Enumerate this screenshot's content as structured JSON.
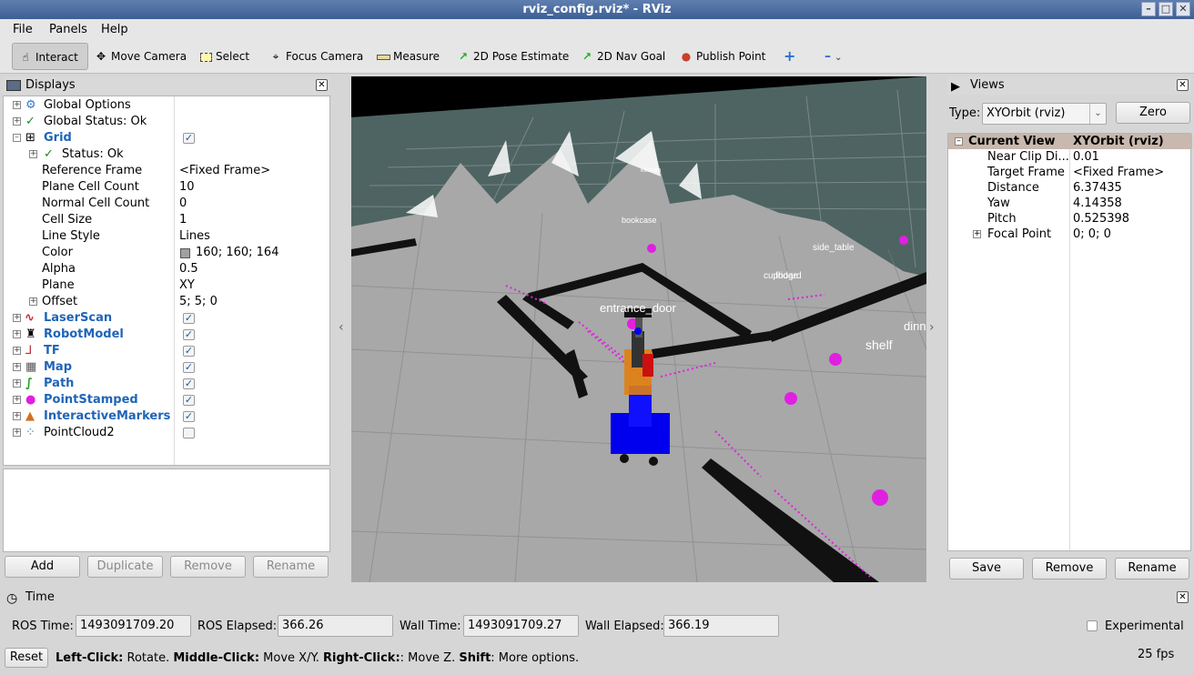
{
  "window": {
    "title": "rviz_config.rviz* - RViz"
  },
  "menu": [
    "File",
    "Panels",
    "Help"
  ],
  "toolbar": {
    "interact": "Interact",
    "move_camera": "Move Camera",
    "select": "Select",
    "focus_camera": "Focus Camera",
    "measure": "Measure",
    "pose_estimate": "2D Pose Estimate",
    "nav_goal": "2D Nav Goal",
    "publish_point": "Publish Point"
  },
  "displays": {
    "title": "Displays",
    "rows": [
      {
        "label": "Global Options"
      },
      {
        "label": "Global Status: Ok"
      },
      {
        "label": "Grid"
      },
      {
        "label": "Status: Ok"
      },
      {
        "label": "Reference Frame",
        "value": "<Fixed Frame>"
      },
      {
        "label": "Plane Cell Count",
        "value": "10"
      },
      {
        "label": "Normal Cell Count",
        "value": "0"
      },
      {
        "label": "Cell Size",
        "value": "1"
      },
      {
        "label": "Line Style",
        "value": "Lines"
      },
      {
        "label": "Color",
        "value": "160; 160; 164"
      },
      {
        "label": "Alpha",
        "value": "0.5"
      },
      {
        "label": "Plane",
        "value": "XY"
      },
      {
        "label": "Offset",
        "value": "5; 5; 0"
      },
      {
        "label": "LaserScan"
      },
      {
        "label": "RobotModel"
      },
      {
        "label": "TF"
      },
      {
        "label": "Map"
      },
      {
        "label": "Path"
      },
      {
        "label": "PointStamped"
      },
      {
        "label": "InteractiveMarkers"
      },
      {
        "label": "PointCloud2"
      }
    ],
    "buttons": {
      "add": "Add",
      "duplicate": "Duplicate",
      "remove": "Remove",
      "rename": "Rename"
    }
  },
  "scene_labels": {
    "entrance_door": "entrance_door",
    "shelf": "shelf",
    "side_table": "side_table",
    "bookcase": "bookcase",
    "cupboard": "cupboard",
    "fridge": "fridge",
    "dinner": "dinn",
    "kitchen": "kitchen"
  },
  "views": {
    "title": "Views",
    "type_label": "Type:",
    "type_value": "XYOrbit (rviz)",
    "zero": "Zero",
    "current_view": "Current View",
    "current_view_value": "XYOrbit (rviz)",
    "props": [
      {
        "key": "Near Clip Di...",
        "value": "0.01"
      },
      {
        "key": "Target Frame",
        "value": "<Fixed Frame>"
      },
      {
        "key": "Distance",
        "value": "6.37435"
      },
      {
        "key": "Yaw",
        "value": "4.14358"
      },
      {
        "key": "Pitch",
        "value": "0.525398"
      },
      {
        "key": "Focal Point",
        "value": "0; 0; 0"
      }
    ],
    "buttons": {
      "save": "Save",
      "remove": "Remove",
      "rename": "Rename"
    }
  },
  "time": {
    "title": "Time",
    "ros_time_label": "ROS Time:",
    "ros_time": "1493091709.20",
    "ros_elapsed_label": "ROS Elapsed:",
    "ros_elapsed": "366.26",
    "wall_time_label": "Wall Time:",
    "wall_time": "1493091709.27",
    "wall_elapsed_label": "Wall Elapsed:",
    "wall_elapsed": "366.19",
    "experimental": "Experimental"
  },
  "status": {
    "reset": "Reset",
    "left_click": "Left-Click:",
    "left_action": " Rotate. ",
    "middle_click": "Middle-Click:",
    "middle_action": " Move X/Y. ",
    "right_click": "Right-Click:",
    "right_action": ": Move Z. ",
    "shift": "Shift",
    "shift_action": ": More options.",
    "fps": "25 fps"
  },
  "colors": {
    "grid_color": "#a0a0a4",
    "accent_blue": "#1f64b8",
    "marker_magenta": "#e020e0"
  }
}
